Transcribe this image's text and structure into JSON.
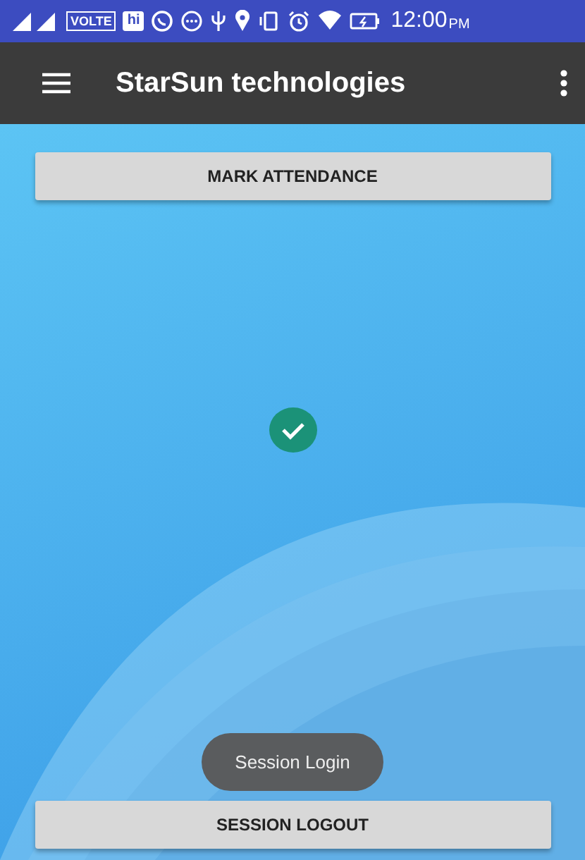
{
  "status_bar": {
    "network_badge": "VOLTE",
    "app_badge": "hi",
    "time": "12:00",
    "time_suffix": "PM"
  },
  "app_bar": {
    "title": "StarSun technologies"
  },
  "content": {
    "top_button": "MARK ATTENDANCE",
    "bottom_button": "SESSION LOGOUT",
    "toast": "Session Login"
  }
}
